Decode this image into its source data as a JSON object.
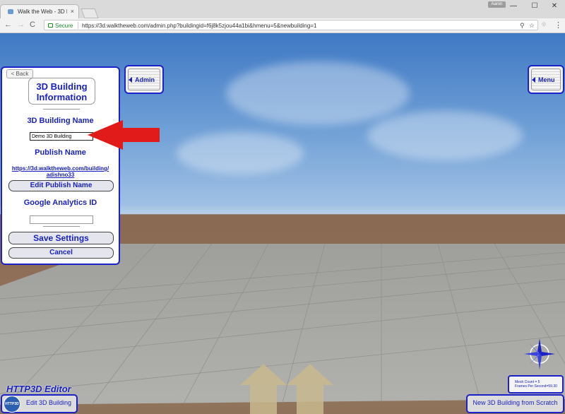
{
  "browser": {
    "tab_title": "Walk the Web - 3D Buildi",
    "tab_close": "×",
    "user_chip": "Aaron",
    "win_minimize": "—",
    "win_maximize": "☐",
    "win_close": "✕",
    "nav_back": "←",
    "nav_forward": "→",
    "nav_reload": "C",
    "secure_label": "Secure",
    "url": "https://3d.walktheweb.com/admin.php?buildingid=f6j8k5zjou44a1bi&hmenu=5&newbuilding=1",
    "icons": [
      "pin-icon",
      "star-icon",
      "extension-icon",
      "menu-icon"
    ]
  },
  "panel": {
    "back_label": "< Back",
    "title_line1": "3D Building",
    "title_line2": "Information",
    "building_name_label": "3D Building Name",
    "building_name_value": "Demo 3D Building",
    "publish_name_label": "Publish Name",
    "publish_url_line1": "https://3d.walktheweb.com/building/",
    "publish_url_line2": "adishno33",
    "edit_publish_label": "Edit Publish Name",
    "ga_label": "Google Analytics ID",
    "ga_value": "",
    "save_label": "Save Settings",
    "cancel_label": "Cancel"
  },
  "side_buttons": {
    "admin_label": "Admin",
    "menu_label": "Menu"
  },
  "footer": {
    "editor_label": "HTTP3D Editor",
    "logo_text": "HTTP3D",
    "edit_building_label": "Edit 3D Building",
    "new_building_label": "New 3D Building from Scratch",
    "mesh_count": "Mesh Count = 5",
    "fps": "Frames Per Second=59.30"
  },
  "colors": {
    "accent_blue": "#1c22c8",
    "arrow_red": "#e11a1a"
  }
}
